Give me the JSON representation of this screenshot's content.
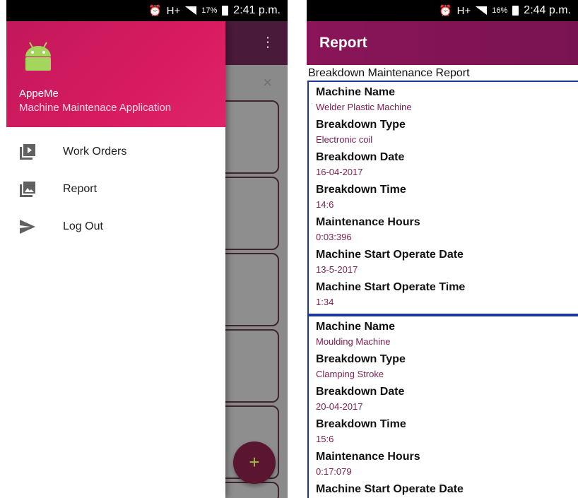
{
  "left_phone": {
    "status_bar": {
      "time": "2:41 p.m.",
      "battery": "17%",
      "alarm_icon": "alarm-clock-icon",
      "network": "H+"
    },
    "drawer": {
      "app_name": "AppeMe",
      "app_subtitle": "Machine Maintenace Application",
      "menu_items": [
        {
          "label": "Work Orders",
          "icon": "video-library-icon"
        },
        {
          "label": "Report",
          "icon": "photo-library-icon"
        },
        {
          "label": "Log Out",
          "icon": "send-icon"
        }
      ]
    },
    "background_fab_symbol": "+",
    "background_close_symbol": "×",
    "background_menu_symbol": "⋮"
  },
  "right_phone": {
    "status_bar": {
      "time": "2:44 p.m.",
      "battery": "16%",
      "alarm_icon": "alarm-clock-icon",
      "network": "H+"
    },
    "appbar_title": "Report",
    "report_heading": "Breakdown Maintenance Report",
    "records": [
      {
        "fields": [
          {
            "label": "Machine Name",
            "value": "Welder Plastic Machine"
          },
          {
            "label": "Breakdown Type",
            "value": "Electronic coil"
          },
          {
            "label": "Breakdown Date",
            "value": "16-04-2017"
          },
          {
            "label": "Breakdown Time",
            "value": "14:6"
          },
          {
            "label": "Maintenance Hours",
            "value": "0:03:396"
          },
          {
            "label": "Machine Start Operate Date",
            "value": "13-5-2017"
          },
          {
            "label": "Machine Start Operate Time",
            "value": "1:34"
          }
        ]
      },
      {
        "fields": [
          {
            "label": "Machine Name",
            "value": "Moulding Machine"
          },
          {
            "label": "Breakdown Type",
            "value": "Clamping Stroke"
          },
          {
            "label": "Breakdown Date",
            "value": "20-04-2017"
          },
          {
            "label": "Breakdown Time",
            "value": "15:6"
          },
          {
            "label": "Maintenance Hours",
            "value": "0:17:079"
          },
          {
            "label": "Machine Start Operate Date",
            "value": ""
          }
        ]
      }
    ]
  },
  "colors": {
    "drawer_header": "#d81b60",
    "appbar": "#8a1559",
    "value_text": "#7b1d4e",
    "record_border": "#1d3796"
  }
}
